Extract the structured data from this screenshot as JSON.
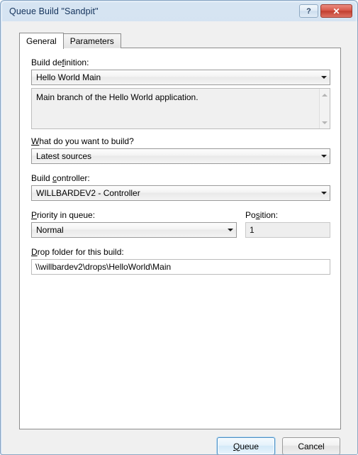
{
  "window": {
    "title": "Queue Build \"Sandpit\"",
    "help_label": "?",
    "close_label": "✕"
  },
  "tabs": [
    {
      "label": "General",
      "active": true
    },
    {
      "label": "Parameters",
      "active": false
    }
  ],
  "form": {
    "build_definition": {
      "label_before": "Build de",
      "label_accel": "f",
      "label_after": "inition:",
      "value": "Hello World Main"
    },
    "description": {
      "value": "Main branch of the Hello World application."
    },
    "what_to_build": {
      "label_before": "",
      "label_accel": "W",
      "label_after": "hat do you want to build?",
      "value": "Latest sources"
    },
    "build_controller": {
      "label_before": "Build ",
      "label_accel": "c",
      "label_after": "ontroller:",
      "value": "WILLBARDEV2 - Controller"
    },
    "priority": {
      "label_before": "",
      "label_accel": "P",
      "label_after": "riority in queue:",
      "value": "Normal"
    },
    "position": {
      "label_before": "Po",
      "label_accel": "s",
      "label_after": "ition:",
      "value": "1"
    },
    "drop_folder": {
      "label_before": "",
      "label_accel": "D",
      "label_after": "rop folder for this build:",
      "value": "\\\\willbardev2\\drops\\HelloWorld\\Main"
    }
  },
  "footer": {
    "queue_before": "",
    "queue_accel": "Q",
    "queue_after": "ueue",
    "cancel_label": "Cancel"
  },
  "colors": {
    "frame": "#c8d9ee",
    "title_text": "#13325b",
    "close_red": "#c13f30",
    "default_button_border": "#4c8fc4"
  }
}
